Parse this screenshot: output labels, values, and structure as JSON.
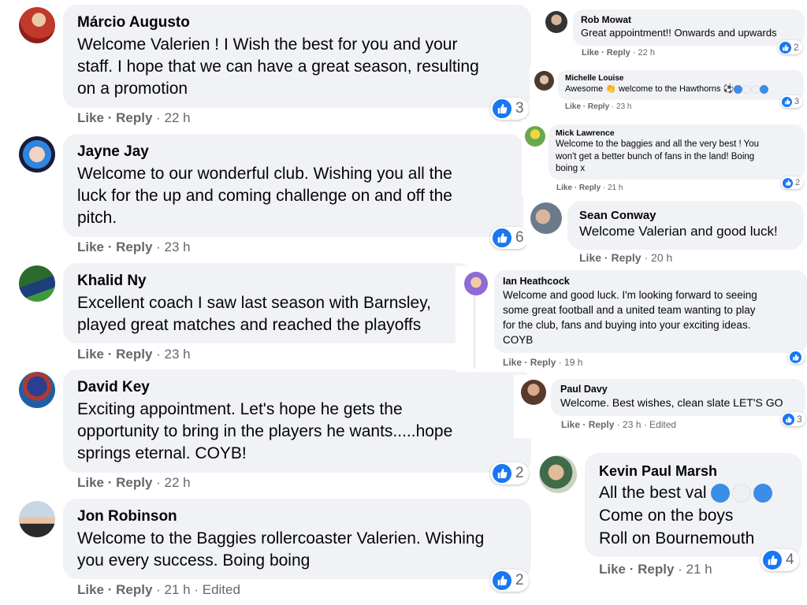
{
  "left_comments": [
    {
      "name": "Márcio Augusto",
      "lines": [
        "Welcome Valerien ! I Wish the best for you and your",
        "staff. I hope that we can have a great season, resulting",
        "on a promotion"
      ],
      "like": "Like",
      "reply": "Reply",
      "meta": " · 22 h",
      "reactions": "3"
    },
    {
      "name": "Jayne Jay",
      "lines": [
        "Welcome to our wonderful club. Wishing you all the",
        "luck for the up and coming challenge on and off the",
        "pitch."
      ],
      "like": "Like",
      "reply": "Reply",
      "meta": " · 23 h",
      "reactions": "6"
    },
    {
      "name": "Khalid Ny",
      "lines": [
        "Excellent coach I saw last season with Barnsley,",
        "played great matches and reached the playoffs"
      ],
      "like": "Like",
      "reply": "Reply",
      "meta": " · 23 h",
      "reactions": ""
    },
    {
      "name": "David Key",
      "lines": [
        "Exciting appointment. Let's hope he gets the",
        "opportunity to bring in the players he wants.....hope",
        "springs eternal. COYB!"
      ],
      "like": "Like",
      "reply": "Reply",
      "meta": " · 22 h",
      "reactions": "2"
    },
    {
      "name": "Jon Robinson",
      "lines": [
        "Welcome to the Baggies rollercoaster Valerien. Wishing",
        "you every success. Boing boing"
      ],
      "like": "Like",
      "reply": "Reply",
      "meta": " · 21 h · Edited",
      "reactions": "2"
    }
  ],
  "right_comments": [
    {
      "name": "Rob Mowat",
      "lines": [
        "Great appointment!! Onwards and upwards"
      ],
      "like": "Like",
      "reply": "Reply",
      "meta": " · 22 h",
      "reactions": "2"
    },
    {
      "name": "Michelle Louise",
      "lines": [
        "Awesome",
        "welcome to the Hawthorns"
      ],
      "like": "Like",
      "reply": "Reply",
      "meta": " · 23 h",
      "reactions": "3"
    },
    {
      "name": "Mick Lawrence",
      "lines": [
        "Welcome to the baggies and all the very best ! You",
        "won't get a better bunch of fans in the land! Boing",
        "boing x"
      ],
      "like": "Like",
      "reply": "Reply",
      "meta": " · 21 h",
      "reactions": "2"
    },
    {
      "name": "Sean Conway",
      "lines": [
        "Welcome Valerian and good luck!"
      ],
      "like": "Like",
      "reply": "Reply",
      "meta": " · 20 h",
      "reactions": ""
    },
    {
      "name": "Ian Heathcock",
      "lines": [
        "Welcome and good luck. I'm looking forward to seeing",
        "some great football and a united team wanting to play",
        "for the club, fans and buying into your exciting ideas.",
        "COYB"
      ],
      "like": "Like",
      "reply": "Reply",
      "meta": " · 19 h",
      "reactions": ""
    },
    {
      "name": "Paul Davy",
      "lines": [
        "Welcome. Best wishes, clean slate LET'S GO"
      ],
      "like": "Like",
      "reply": "Reply",
      "meta": " · 23 h · Edited",
      "reactions": "3"
    },
    {
      "name": "Kevin Paul Marsh",
      "lines": [
        "All the best val",
        "Come on the boys",
        "Roll on Bournemouth"
      ],
      "like": "Like",
      "reply": "Reply",
      "meta": " · 21 h",
      "reactions": "4"
    }
  ],
  "colors": {
    "bubble": "#f0f2f5",
    "action_text": "#65676b",
    "like_blue": "#1877f2",
    "emoji_blue": "#3b8de6"
  },
  "icons": {
    "reaction": "like-thumb-icon",
    "emoji_ball": "football-emoji-icon",
    "emoji_clap": "clapping-hands-emoji-icon",
    "emoji_circle": "blue-circle-emoji-icon"
  }
}
